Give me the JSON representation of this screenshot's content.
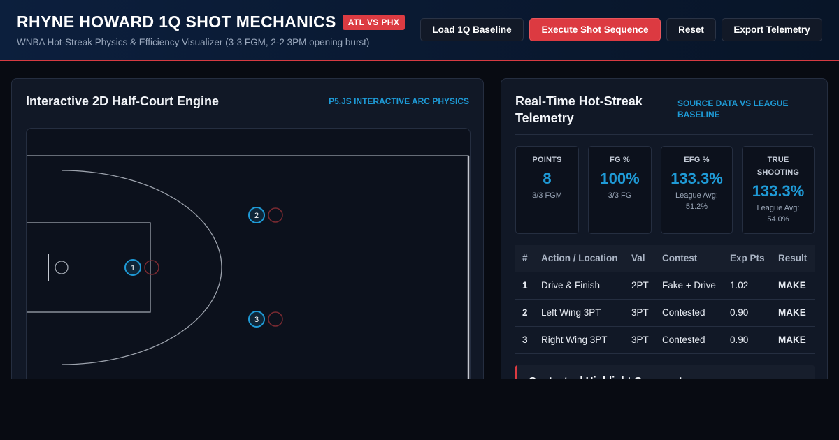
{
  "header": {
    "title": "RHYNE HOWARD 1Q SHOT MECHANICS",
    "badge": "ATL VS PHX",
    "subtitle": "WNBA Hot-Streak Physics & Efficiency Visualizer (3-3 FGM, 2-2 3PM opening burst)",
    "buttons": {
      "load": "Load 1Q Baseline",
      "execute": "Execute Shot Sequence",
      "reset": "Reset",
      "export": "Export Telemetry"
    }
  },
  "court_panel": {
    "title": "Interactive 2D Half-Court Engine",
    "tag": "P5.JS INTERACTIVE ARC PHYSICS",
    "shot_markers": [
      "1",
      "2",
      "3"
    ]
  },
  "telemetry_panel": {
    "title_line1": "Real-Time Hot-Streak",
    "title_line2": "Telemetry",
    "tag_line1": "SOURCE DATA VS LEAGUE",
    "tag_line2": "BASELINE",
    "stats": [
      {
        "label": "POINTS",
        "value": "8",
        "sub": "3/3 FGM"
      },
      {
        "label": "FG %",
        "value": "100%",
        "sub": "3/3 FG"
      },
      {
        "label": "EFG %",
        "value": "133.3%",
        "sub_line1": "League Avg:",
        "sub_line2": "51.2%"
      },
      {
        "label_line1": "TRUE",
        "label_line2": "SHOOTING",
        "value": "133.3%",
        "sub_line1": "League Avg:",
        "sub_line2": "54.0%"
      }
    ],
    "table": {
      "headers": [
        "#",
        "Action / Location",
        "Val",
        "Contest",
        "Exp Pts",
        "Result"
      ],
      "rows": [
        [
          "1",
          "Drive & Finish",
          "2PT",
          "Fake + Drive",
          "1.02",
          "MAKE"
        ],
        [
          "2",
          "Left Wing 3PT",
          "3PT",
          "Contested",
          "0.90",
          "MAKE"
        ],
        [
          "3",
          "Right Wing 3PT",
          "3PT",
          "Contested",
          "0.90",
          "MAKE"
        ]
      ]
    },
    "highlight_title": "Contextual Highlight Commentary"
  },
  "colors": {
    "accent_blue": "#1f9ad6",
    "accent_red": "#dc3a41",
    "background": "#080b12",
    "panel": "#111826"
  }
}
